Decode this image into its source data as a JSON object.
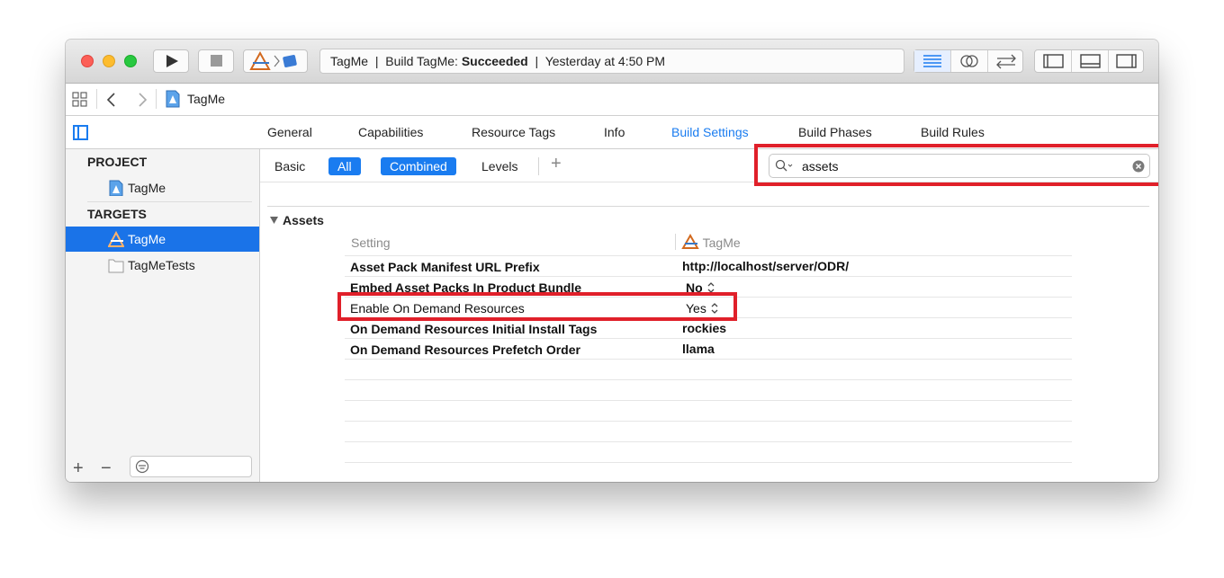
{
  "titlebar": {
    "activity_project": "TagMe",
    "activity_separator": "|",
    "activity_build_prefix": "Build TagMe:",
    "activity_status": "Succeeded",
    "activity_time": "Yesterday at 4:50 PM"
  },
  "jumpbar": {
    "file_label": "TagMe"
  },
  "editor_tabs": [
    {
      "label": "General",
      "active": false
    },
    {
      "label": "Capabilities",
      "active": false
    },
    {
      "label": "Resource Tags",
      "active": false
    },
    {
      "label": "Info",
      "active": false
    },
    {
      "label": "Build Settings",
      "active": true
    },
    {
      "label": "Build Phases",
      "active": false
    },
    {
      "label": "Build Rules",
      "active": false
    }
  ],
  "sidebar": {
    "project_header": "PROJECT",
    "project_item": "TagMe",
    "targets_header": "TARGETS",
    "targets": [
      {
        "label": "TagMe",
        "selected": true
      },
      {
        "label": "TagMeTests",
        "selected": false
      }
    ],
    "add_symbol": "+",
    "remove_symbol": "−"
  },
  "filterbar": {
    "basic": "Basic",
    "all": "All",
    "combined": "Combined",
    "levels": "Levels",
    "add_symbol": "+",
    "search_value": "assets"
  },
  "settings": {
    "section_title": "Assets",
    "column_setting": "Setting",
    "column_target": "TagMe",
    "rows": [
      {
        "name": "Asset Pack Manifest URL Prefix",
        "value": "http://localhost/server/ODR/"
      },
      {
        "name": "Embed Asset Packs In Product Bundle",
        "value": "No"
      },
      {
        "name": "Enable On Demand Resources",
        "value": "Yes"
      },
      {
        "name": "On Demand Resources Initial Install Tags",
        "value": "rockies"
      },
      {
        "name": "On Demand Resources Prefetch Order",
        "value": "llama"
      }
    ]
  },
  "colors": {
    "accent": "#1a7cf0",
    "selection": "#1a73e8",
    "highlight_box": "#e0202a",
    "close": "#fc5f57",
    "minimize": "#fdbc2e",
    "zoom": "#28c840"
  },
  "icons": [
    "play-icon",
    "stop-icon",
    "xcode-app-icon",
    "simulator-icon",
    "navigator-list-icon",
    "assistant-editor-icon",
    "version-editor-icon",
    "left-panel-icon",
    "bottom-panel-icon",
    "right-panel-icon",
    "grid-icon",
    "back-arrow-icon",
    "forward-arrow-icon",
    "project-file-icon",
    "sidebar-toggle-icon",
    "search-icon",
    "clear-search-icon",
    "filter-icon",
    "disclosure-triangle-icon",
    "stepper-icon"
  ]
}
